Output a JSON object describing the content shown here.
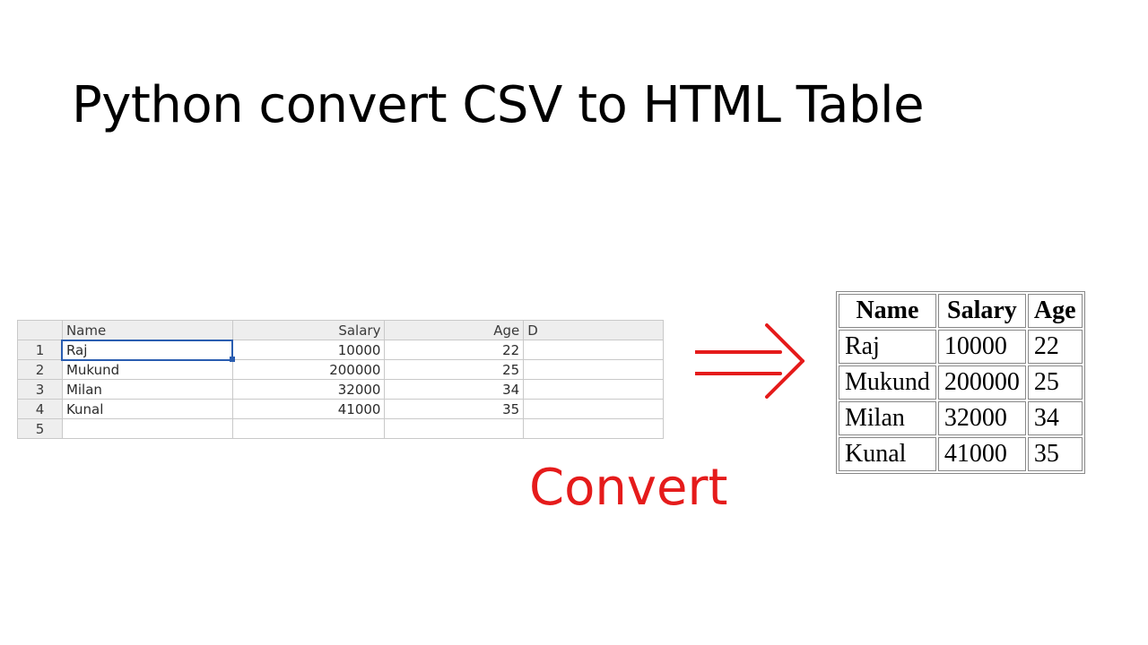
{
  "title": "Python convert CSV to HTML Table",
  "convert_label": "Convert",
  "colors": {
    "accent_red": "#e51b1b",
    "selection_blue": "#2a5db0"
  },
  "spreadsheet": {
    "columns": [
      "Name",
      "Salary",
      "Age",
      "D"
    ],
    "row_numbers": [
      "1",
      "2",
      "3",
      "4",
      "5"
    ],
    "rows": [
      {
        "name": "Raj",
        "salary": "10000",
        "age": "22",
        "d": ""
      },
      {
        "name": "Mukund",
        "salary": "200000",
        "age": "25",
        "d": ""
      },
      {
        "name": "Milan",
        "salary": "32000",
        "age": "34",
        "d": ""
      },
      {
        "name": "Kunal",
        "salary": "41000",
        "age": "35",
        "d": ""
      },
      {
        "name": "",
        "salary": "",
        "age": "",
        "d": ""
      }
    ],
    "selected_cell": "A1"
  },
  "html_table": {
    "headers": [
      "Name",
      "Salary",
      "Age"
    ],
    "rows": [
      {
        "name": "Raj",
        "salary": "10000",
        "age": "22"
      },
      {
        "name": "Mukund",
        "salary": "200000",
        "age": "25"
      },
      {
        "name": "Milan",
        "salary": "32000",
        "age": "34"
      },
      {
        "name": "Kunal",
        "salary": "41000",
        "age": "35"
      }
    ]
  }
}
